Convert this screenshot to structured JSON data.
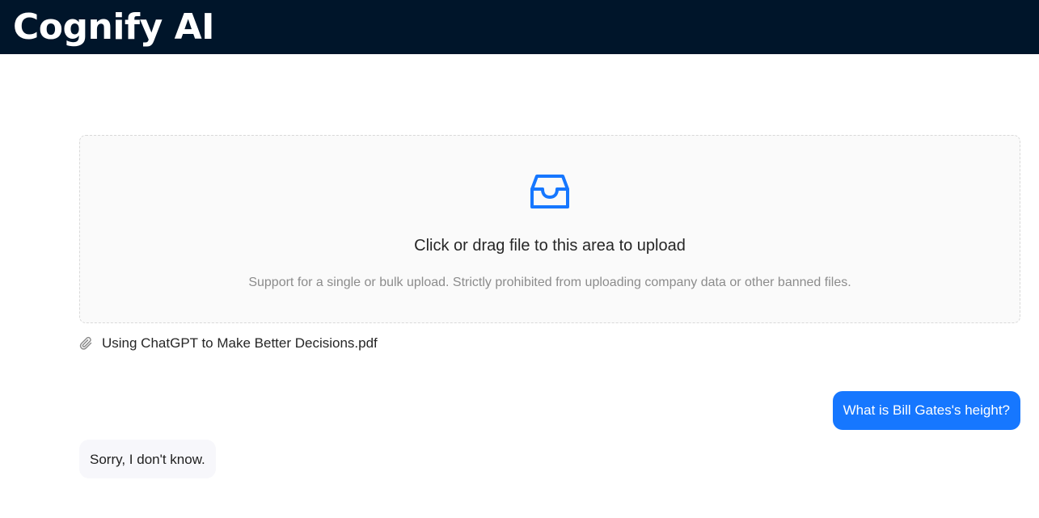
{
  "header": {
    "title": "Cognify AI",
    "background_color": "#00152a"
  },
  "upload": {
    "icon": "inbox-icon",
    "text": "Click or drag file to this area to upload",
    "hint": "Support for a single or bulk upload. Strictly prohibited from uploading company data or other banned files.",
    "accent_color": "#1677ff"
  },
  "files": [
    {
      "icon": "paperclip-icon",
      "name": "Using ChatGPT to Make Better Decisions.pdf"
    }
  ],
  "messages": [
    {
      "role": "user",
      "text": "What is Bill Gates's height?"
    },
    {
      "role": "assistant",
      "text": "Sorry, I don't know."
    }
  ]
}
